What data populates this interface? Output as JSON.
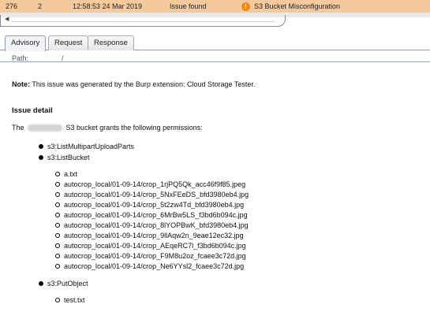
{
  "issues_table": {
    "selected_row": {
      "id": "276",
      "count": "2",
      "time": "12:58:53 24 Mar 2019",
      "type": "Issue found",
      "issue": "S3 Bucket Misconfiguration"
    }
  },
  "tabs": [
    {
      "label": "Advisory"
    },
    {
      "label": "Request"
    },
    {
      "label": "Response"
    }
  ],
  "advisory": {
    "path_label": "Path:",
    "path_value": "/",
    "note_label": "Note:",
    "note_text": " This issue was generated by the Burp extension: Cloud Storage Tester.",
    "detail_heading": "Issue detail",
    "lead_prefix": "The",
    "lead_suffix": "S3 bucket grants the following permissions:",
    "permissions": [
      {
        "name": "s3:ListMultipartUploadParts",
        "files": []
      },
      {
        "name": "s3:ListBucket",
        "files": [
          "a.txt",
          "autocrop_local/01-09-14/crop_1rjPQ5Qk_acc46f9f85.jpeg",
          "autocrop_local/01-09-14/crop_5NxFEeDS_bfd3980eb4.jpg",
          "autocrop_local/01-09-14/crop_5t2zw4Td_bfd3980eb4.jpg",
          "autocrop_local/01-09-14/crop_6MrBw5LS_f3bd6b094c.jpg",
          "autocrop_local/01-09-14/crop_8lYOPBwK_bfd3980eb4.jpg",
          "autocrop_local/01-09-14/crop_9llAqw2n_9eae12ec32.jpg",
          "autocrop_local/01-09-14/crop_AEqeRC7l_f3bd6b094c.jpg",
          "autocrop_local/01-09-14/crop_F9M8u2oz_fcaee3c72d.jpg",
          "autocrop_local/01-09-14/crop_Ne6YYsl2_fcaee3c72d.jpg"
        ]
      },
      {
        "name": "s3:PutObject",
        "files": [
          "test.txt"
        ]
      }
    ]
  },
  "colors": {
    "selected_row": "#f6c99c",
    "warning_icon": "#f08a1a"
  }
}
